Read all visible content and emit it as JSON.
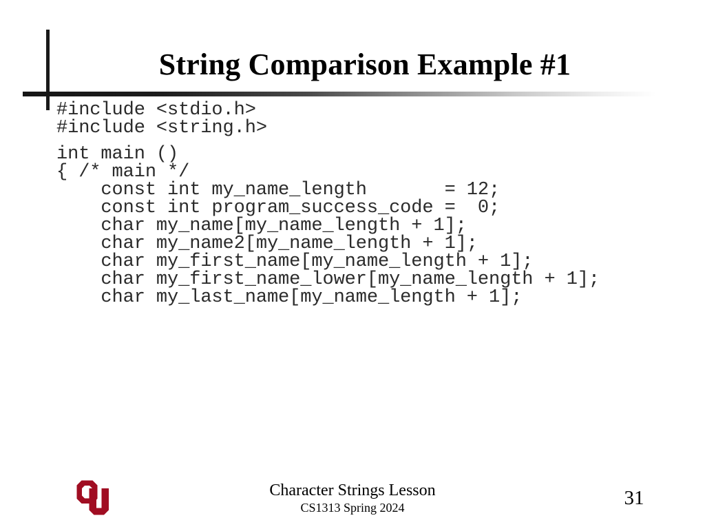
{
  "slide": {
    "title": "String Comparison Example #1",
    "page_number": "31",
    "background_color": "#ffffff",
    "title_color": "#000000",
    "code_color": "#2b2b2b",
    "logo_color": "#A00D22"
  },
  "code": {
    "blocks": [
      {
        "lines": [
          "#include <stdio.h>",
          "#include <string.h>"
        ]
      },
      {
        "lines": [
          "int main ()",
          "{ /* main */",
          "    const int my_name_length       = 12;",
          "    const int program_success_code =  0;",
          "    char my_name[my_name_length + 1];",
          "    char my_name2[my_name_length + 1];",
          "    char my_first_name[my_name_length + 1];",
          "    char my_first_name_lower[my_name_length + 1];",
          "    char my_last_name[my_name_length + 1];"
        ]
      }
    ]
  },
  "footer": {
    "lesson": "Character Strings Lesson",
    "course": "CS1313 Spring 2024",
    "logo_alt": "OU"
  }
}
